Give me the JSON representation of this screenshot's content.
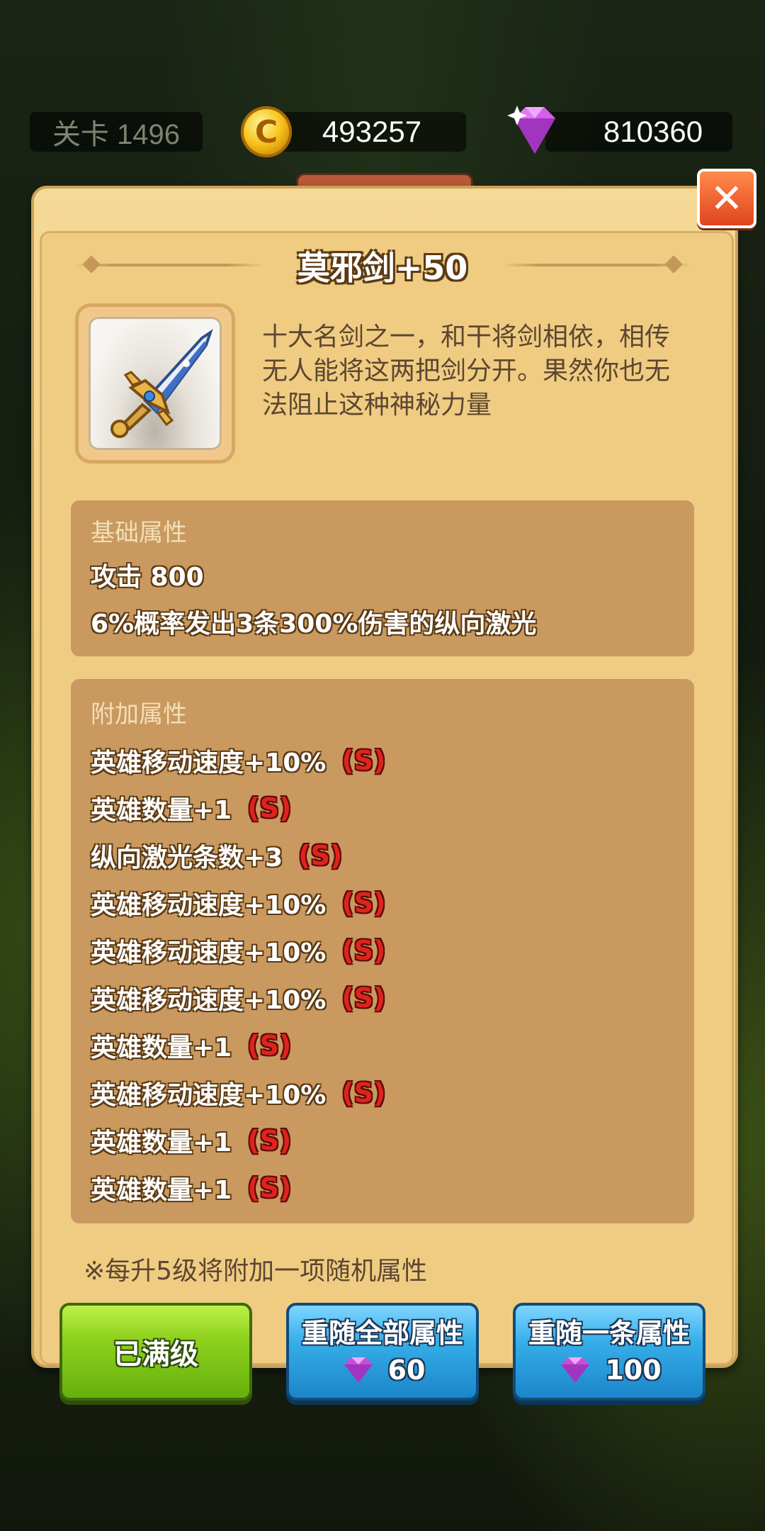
{
  "hud": {
    "level_label": "关卡 1496",
    "coins": "493257",
    "gems": "810360"
  },
  "dialog": {
    "title": "莫邪剑+50",
    "description": "十大名剑之一，和干将剑相依，相传无人能将这两把剑分开。果然你也无法阻止这种神秘力量",
    "base": {
      "header": "基础属性",
      "lines": [
        "攻击 800",
        "6%概率发出3条300%伤害的纵向激光"
      ]
    },
    "extra": {
      "header": "附加属性",
      "badge": "(S)",
      "lines": [
        "英雄移动速度+10%",
        "英雄数量+1",
        "纵向激光条数+3",
        "英雄移动速度+10%",
        "英雄移动速度+10%",
        "英雄移动速度+10%",
        "英雄数量+1",
        "英雄移动速度+10%",
        "英雄数量+1",
        "英雄数量+1"
      ]
    },
    "note": "※每升5级将附加一项随机属性",
    "buttons": {
      "max_level": "已满级",
      "reroll_all": {
        "label": "重随全部属性",
        "cost": "60"
      },
      "reroll_one": {
        "label": "重随一条属性",
        "cost": "100"
      }
    },
    "close_icon": "close-icon"
  },
  "colors": {
    "panel": "#c9995f",
    "badge": "#e0231c",
    "green_button": "#8fd21e",
    "blue_button": "#35aee9"
  }
}
